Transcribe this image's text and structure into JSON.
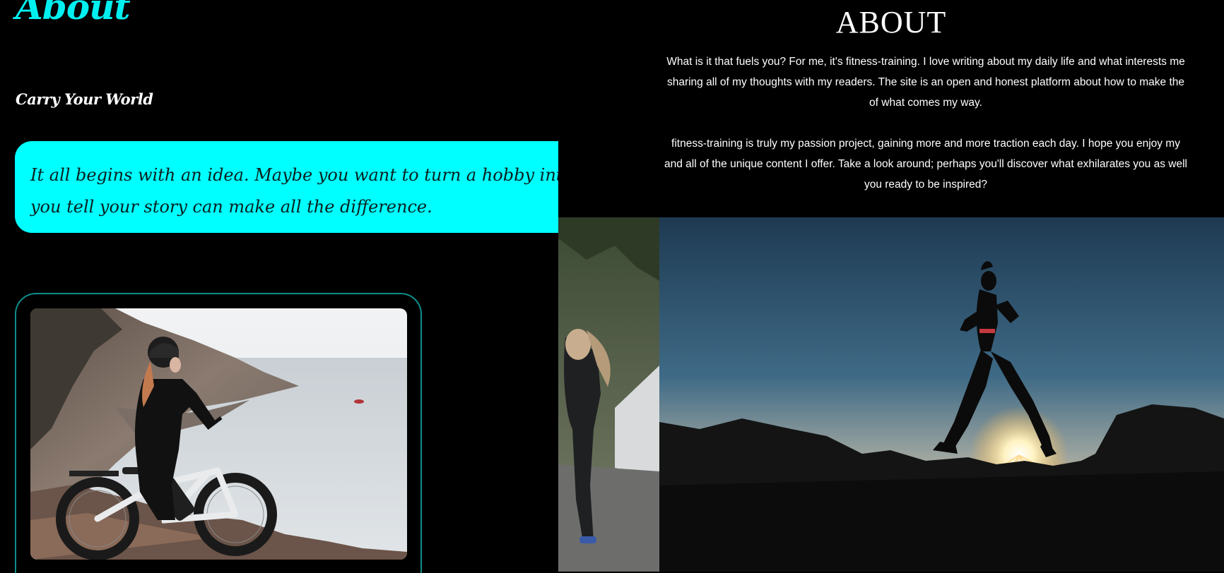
{
  "left": {
    "heading": "About",
    "tagline": "Carry Your World",
    "idea_text_line1": "It all begins with an idea. Maybe you want to turn a hobby into something",
    "idea_text_line2": "you tell your story can make all the difference.",
    "photo_icon": "woman-with-ebike-photo"
  },
  "right": {
    "title": "ABOUT",
    "paragraph1_line1": "What is it that fuels you? For me, it's fitness-training. I love writing about my daily life and what interests me",
    "paragraph1_line2": "sharing all of my thoughts with my readers. The site is an open and honest platform about how to make the",
    "paragraph1_line3": "of what comes my way.",
    "paragraph2_line1": "fitness-training is truly my passion project, gaining more and more traction each day. I hope you enjoy my",
    "paragraph2_line2": "and all of the unique content I offer. Take a look around; perhaps you'll discover what exhilarates you as well",
    "paragraph2_line3": "you ready to be inspired?",
    "photo_icon": "runner-at-sunset-photo"
  },
  "colors": {
    "accent": "#00ffff",
    "heading_cyan": "#00f0f0",
    "frame_teal": "#0e8c8a",
    "background": "#000000"
  }
}
